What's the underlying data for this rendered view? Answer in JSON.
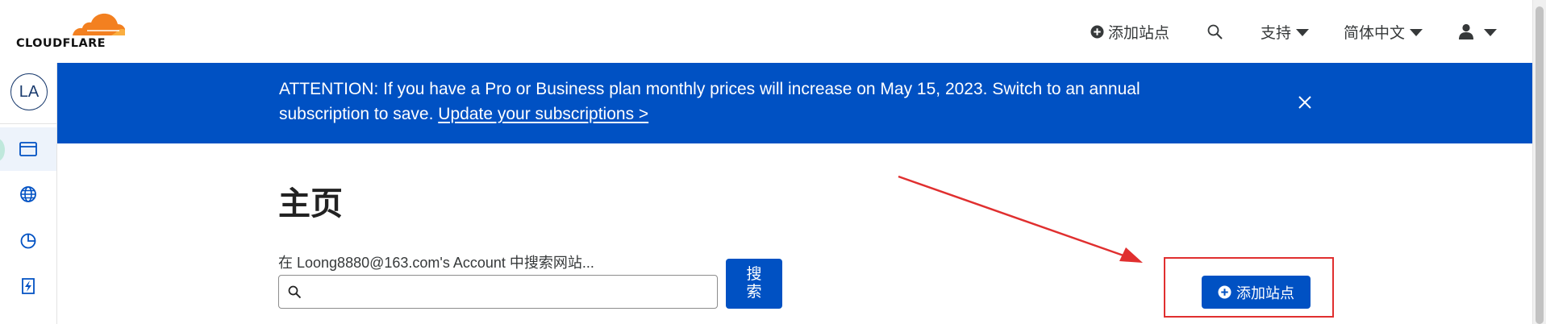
{
  "brand": {
    "logo_text": "CLOUDFLARE",
    "orange": "#f38020",
    "orange_light": "#faae40"
  },
  "header": {
    "add_site": {
      "icon": "plus-circle-icon",
      "label": "添加站点"
    },
    "search_icon": "search-icon",
    "support": {
      "label": "支持"
    },
    "language": {
      "label": "简体中文"
    },
    "user": {
      "icon": "user-icon"
    }
  },
  "sidebar": {
    "avatar_initials": "LA",
    "items": [
      {
        "icon": "website-icon",
        "active": true
      },
      {
        "icon": "globe-icon",
        "active": false
      },
      {
        "icon": "analytics-pie-icon",
        "active": false
      },
      {
        "icon": "workers-bolt-icon",
        "active": false
      }
    ]
  },
  "banner": {
    "text": "ATTENTION: If you have a Pro or Business plan monthly prices will increase on May 15, 2023. Switch to an annual subscription to save.",
    "link": "Update your subscriptions >",
    "close_icon": "close-icon",
    "background": "#0051c3"
  },
  "main": {
    "title": "主页",
    "search": {
      "label": "在 Loong8880@163.com's Account 中搜索网站...",
      "value": "",
      "button": "搜索"
    },
    "add_site_button": "添加站点"
  },
  "colors": {
    "primary": "#0051c3",
    "annotation": "#e02f2f"
  }
}
